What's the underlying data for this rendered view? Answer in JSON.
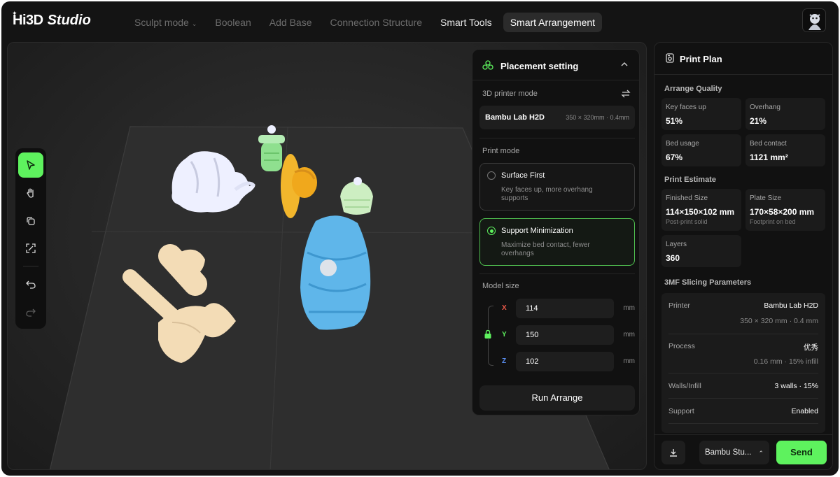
{
  "app": {
    "brand": "Hi3D",
    "brand_suffix": "Studio"
  },
  "nav": {
    "items": [
      {
        "label": "Sculpt mode",
        "has_caret": true
      },
      {
        "label": "Boolean"
      },
      {
        "label": "Add Base"
      },
      {
        "label": "Connection Structure"
      },
      {
        "label": "Smart Tools"
      },
      {
        "label": "Smart Arrangement",
        "active": true
      }
    ]
  },
  "toolbar": {
    "tools": [
      "select-icon",
      "hand-pan-icon",
      "rotate-copy-icon",
      "fit-view-icon",
      "undo-icon",
      "redo-icon"
    ],
    "active_tool": "select-icon"
  },
  "placement": {
    "title": "Placement setting",
    "printer_mode_label": "3D printer mode",
    "printer_name": "Bambu Lab H2D",
    "printer_spec": "350 × 320mm · 0.4mm",
    "print_mode_label": "Print mode",
    "modes": [
      {
        "title": "Surface First",
        "desc": "Key faces up, more overhang supports",
        "selected": false
      },
      {
        "title": "Support Minimization",
        "desc": "Maximize bed contact, fewer overhangs",
        "selected": true
      }
    ],
    "model_size_label": "Model size",
    "size": {
      "x": {
        "axis": "X",
        "value": "114",
        "unit": "mm"
      },
      "y": {
        "axis": "Y",
        "value": "150",
        "unit": "mm"
      },
      "z": {
        "axis": "Z",
        "value": "102",
        "unit": "mm"
      }
    },
    "run_button": "Run Arrange"
  },
  "plan": {
    "title": "Print Plan",
    "quality_label": "Arrange Quality",
    "quality": [
      {
        "label": "Key faces up",
        "value": "51%"
      },
      {
        "label": "Overhang",
        "value": "21%"
      },
      {
        "label": "Bed usage",
        "value": "67%"
      },
      {
        "label": "Bed contact",
        "value": "1121 mm²"
      }
    ],
    "estimate_label": "Print Estimate",
    "estimate": [
      {
        "label": "Finished Size",
        "value": "114×150×102 mm",
        "sub": "Post-print solid"
      },
      {
        "label": "Plate Size",
        "value": "170×58×200 mm",
        "sub": "Footprint on bed"
      },
      {
        "label": "Layers",
        "value": "360"
      }
    ],
    "slicing_label": "3MF Slicing Parameters",
    "params": [
      {
        "key": "Printer",
        "value": "Bambu Lab H2D",
        "sub": "350 × 320 mm · 0.4 mm"
      },
      {
        "key": "Process",
        "value": "优秀",
        "sub": "0.16 mm · 15% infill"
      },
      {
        "key": "Walls/Infill",
        "value": "3 walls · 15%"
      },
      {
        "key": "Support",
        "value": "Enabled"
      }
    ],
    "target": "Bambu Stu...",
    "send_button": "Send"
  },
  "colors": {
    "accent": "#5ef25e",
    "model_white": "#eef0ff",
    "model_green": "#8fe08f",
    "model_yellow": "#f2b62c",
    "model_mint": "#cdeec2",
    "model_blue": "#5fb6ea",
    "model_cream": "#f3dcb6"
  }
}
